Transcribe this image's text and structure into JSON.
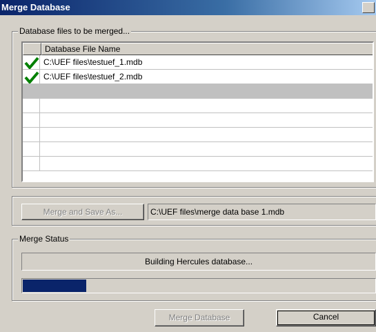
{
  "window": {
    "title": "Merge Database"
  },
  "files_group": {
    "legend": "Database files to be merged...",
    "column_header": "Database File Name",
    "rows": [
      {
        "checked": true,
        "path": "C:\\UEF files\\testuef_1.mdb"
      },
      {
        "checked": true,
        "path": "C:\\UEF files\\testuef_2.mdb"
      },
      {
        "checked": false,
        "path": ""
      },
      {
        "checked": false,
        "path": ""
      },
      {
        "checked": false,
        "path": ""
      },
      {
        "checked": false,
        "path": ""
      },
      {
        "checked": false,
        "path": ""
      },
      {
        "checked": false,
        "path": ""
      }
    ]
  },
  "save": {
    "button_label": "Merge and Save As...",
    "output_path": "C:\\UEF files\\merge data base 1.mdb"
  },
  "status_group": {
    "legend": "Merge Status",
    "status_text": "Building Hercules database...",
    "progress_fraction": 0.18
  },
  "buttons": {
    "merge_label": "Merge Database",
    "cancel_label": "Cancel"
  },
  "colors": {
    "progress": "#0a246a",
    "check": "#008000"
  }
}
